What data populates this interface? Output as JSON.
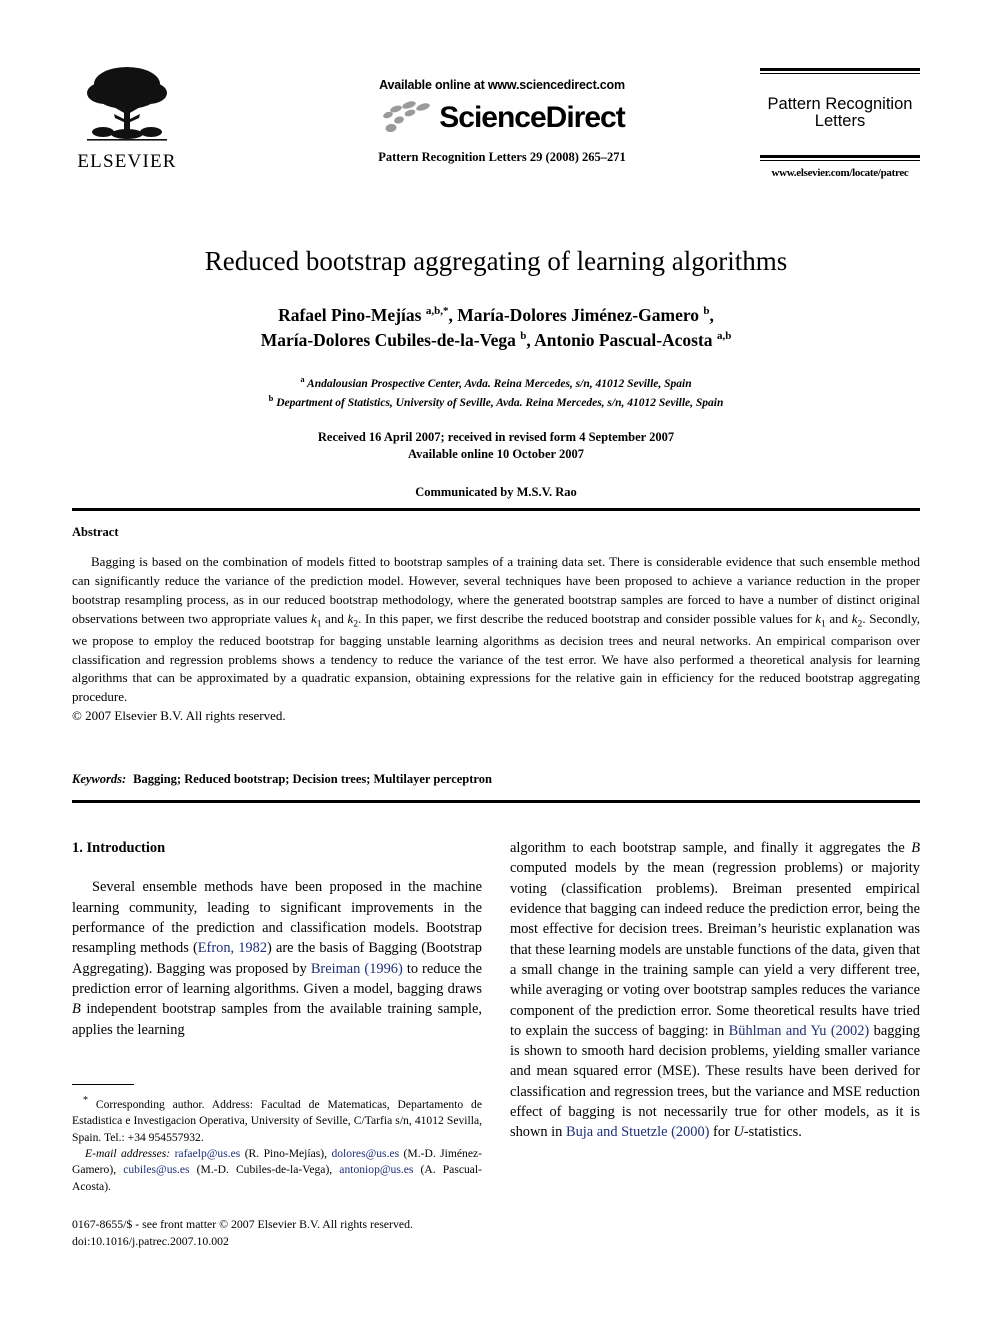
{
  "masthead": {
    "publisher_name": "ELSEVIER",
    "publisher_logo_icon": "elsevier-tree-icon",
    "available_online": "Available online at www.sciencedirect.com",
    "sciencedirect_wordmark": "ScienceDirect",
    "sciencedirect_dots_icon": "sciencedirect-dots-icon",
    "journal_citation": "Pattern Recognition Letters 29 (2008) 265–271",
    "journal_name_line1": "Pattern Recognition",
    "journal_name_line2": "Letters",
    "journal_url": "www.elsevier.com/locate/patrec"
  },
  "title": "Reduced bootstrap aggregating of learning algorithms",
  "authors": {
    "line1_prefix": "Rafael Pino-Mejías ",
    "line1_sup1": "a,b,*",
    "line1_mid": ", María-Dolores Jiménez-Gamero ",
    "line1_sup2": "b",
    "line1_suffix": ",",
    "line2_prefix": "María-Dolores Cubiles-de-la-Vega ",
    "line2_sup1": "b",
    "line2_mid": ", Antonio Pascual-Acosta ",
    "line2_sup2": "a,b"
  },
  "affiliations": [
    {
      "marker": "a",
      "text": "Andalousian Prospective Center, Avda. Reina Mercedes, s/n, 41012 Seville, Spain"
    },
    {
      "marker": "b",
      "text": "Department of Statistics, University of Seville, Avda. Reina Mercedes, s/n, 41012 Seville, Spain"
    }
  ],
  "dates": {
    "received": "Received 16 April 2007; received in revised form 4 September 2007",
    "available_online": "Available online 10 October 2007"
  },
  "communicated_by": "Communicated by M.S.V. Rao",
  "abstract": {
    "heading": "Abstract",
    "text_part1": "Bagging is based on the combination of models fitted to bootstrap samples of a training data set. There is considerable evidence that such ensemble method can significantly reduce the variance of the prediction model. However, several techniques have been proposed to achieve a variance reduction in the proper bootstrap resampling process, as in our reduced bootstrap methodology, where the generated bootstrap samples are forced to have a number of distinct original observations between two appropriate values ",
    "k1_a": "k",
    "k1_a_sub": "1",
    "text_part2": " and ",
    "k2_a": "k",
    "k2_a_sub": "2",
    "text_part3": ". In this paper, we first describe the reduced bootstrap and consider possible values for ",
    "k1_b": "k",
    "k1_b_sub": "1",
    "text_part4": " and ",
    "k2_b": "k",
    "k2_b_sub": "2",
    "text_part5": ". Secondly, we propose to employ the reduced bootstrap for bagging unstable learning algorithms as decision trees and neural networks. An empirical comparison over classification and regression problems shows a tendency to reduce the variance of the test error. We have also performed a theoretical analysis for learning algorithms that can be approximated by a quadratic expansion, obtaining expressions for the relative gain in efficiency for the reduced bootstrap aggregating procedure.",
    "copyright": "© 2007 Elsevier B.V. All rights reserved."
  },
  "keywords": {
    "label": "Keywords:",
    "list": "Bagging; Reduced bootstrap; Decision trees; Multilayer perceptron"
  },
  "body": {
    "section1_heading": "1. Introduction",
    "left_par1_a": "Several ensemble methods have been proposed in the machine learning community, leading to significant improvements in the performance of the prediction and classification models. Bootstrap resampling methods (",
    "left_ref1": "Efron, 1982",
    "left_par1_b": ") are the basis of Bagging (Bootstrap Aggregating). Bagging was proposed by ",
    "left_ref2": "Breiman (1996)",
    "left_par1_c": " to reduce the prediction error of learning algorithms. Given a model, bagging draws ",
    "left_italic_B1": "B",
    "left_par1_d": " independent bootstrap samples from the available training sample, applies the learning",
    "right_par1_a": "algorithm to each bootstrap sample, and finally it aggregates the ",
    "right_italic_B1": "B",
    "right_par1_b": " computed models by the mean (regression problems) or majority voting (classification problems). Breiman presented empirical evidence that bagging can indeed reduce the prediction error, being the most effective for decision trees. Breiman’s heuristic explanation was that these learning models are unstable functions of the data, given that a small change in the training sample can yield a very different tree, while averaging or voting over bootstrap samples reduces the variance component of the prediction error. Some theoretical results have tried to explain the success of bagging: in ",
    "right_ref1": "Bühlman and Yu (2002)",
    "right_par1_c": " bagging is shown to smooth hard decision problems, yielding smaller variance and mean squared error (MSE). These results have been derived for classification and regression trees, but the variance and MSE reduction effect of bagging is not necessarily true for other models, as it is shown in ",
    "right_ref2": "Buja and Stuetzle (2000)",
    "right_par1_d": " for ",
    "right_italic_U": "U",
    "right_par1_e": "-statistics."
  },
  "footnotes": {
    "star": "*",
    "corresponding": " Corresponding author. Address: Facultad de Matematicas, Departamento de Estadistica e Investigacion Operativa, University of Seville, C/Tarfia s/n, 41012 Sevilla, Spain. Tel.: +34 954557932.",
    "email_label": "E-mail addresses:",
    "email1": "rafaelp@us.es",
    "email1_owner": " (R. Pino-Mejías), ",
    "email2": "dolores@us.es",
    "email2_owner": " (M.-D. Jiménez-Gamero), ",
    "email3": "cubiles@us.es",
    "email3_owner": " (M.-D. Cubiles-de-la-Vega), ",
    "email4": "antoniop@us.es",
    "email4_owner": " (A. Pascual-Acosta)."
  },
  "colophon": {
    "front_matter": "0167-8655/$ - see front matter © 2007 Elsevier B.V. All rights reserved.",
    "doi": "doi:10.1016/j.patrec.2007.10.002"
  },
  "colors": {
    "link": "#1d2f7a",
    "text": "#000000",
    "sd_dots": "#9a9a9a"
  }
}
